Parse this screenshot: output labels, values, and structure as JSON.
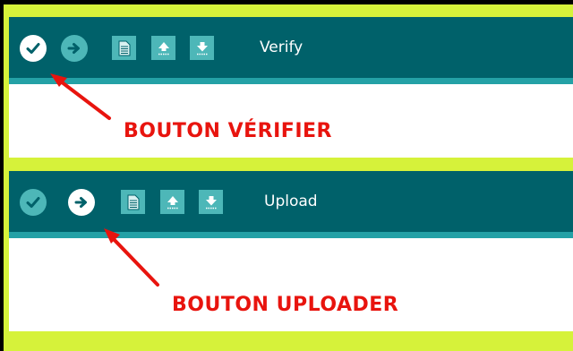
{
  "colors": {
    "background": "#d6f23a",
    "toolbar": "#00616a",
    "toolbar_strip": "#24a1a6",
    "button_idle": "#4db7b8",
    "button_active": "#ffffff",
    "callout": "#e8140e"
  },
  "panels": [
    {
      "hover_label": "Verify",
      "active_button": "verify",
      "callout": "BOUTON VÉRIFIER"
    },
    {
      "hover_label": "Upload",
      "active_button": "upload",
      "callout": "BOUTON UPLOADER"
    }
  ],
  "toolbar_buttons": [
    {
      "id": "verify",
      "icon": "checkmark-icon"
    },
    {
      "id": "upload",
      "icon": "arrow-right-icon"
    },
    {
      "id": "new",
      "icon": "new-file-icon"
    },
    {
      "id": "open",
      "icon": "open-up-arrow-icon"
    },
    {
      "id": "save",
      "icon": "save-down-arrow-icon"
    }
  ]
}
